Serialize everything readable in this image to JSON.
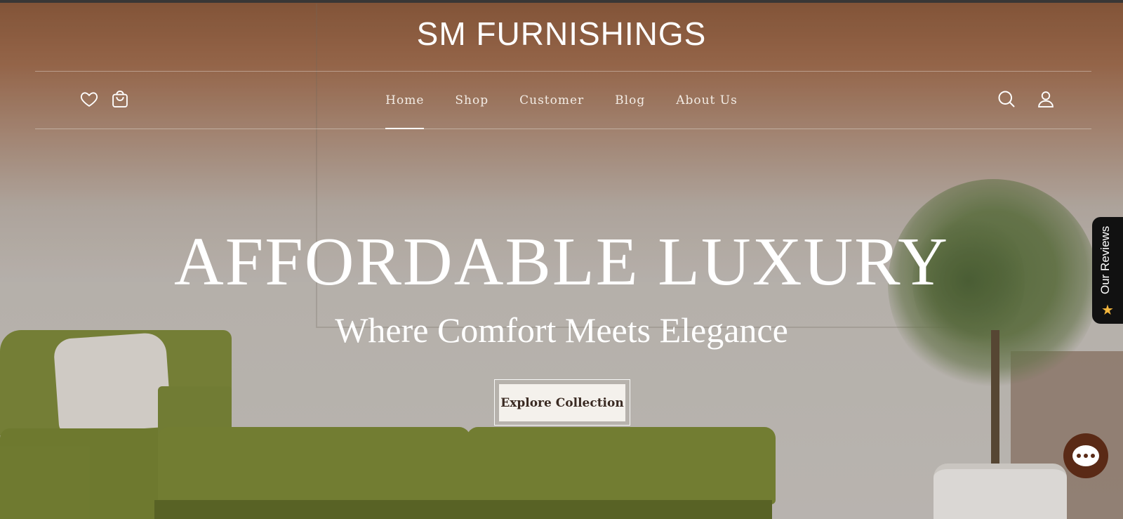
{
  "brand": {
    "name": "SM FURNISHINGS"
  },
  "header": {
    "nav": [
      {
        "label": "Home",
        "active": true
      },
      {
        "label": "Shop",
        "active": false
      },
      {
        "label": "Customer",
        "active": false
      },
      {
        "label": "Blog",
        "active": false
      },
      {
        "label": "About Us",
        "active": false
      }
    ],
    "left_icons": [
      "heart-icon",
      "shopping-bag-icon"
    ],
    "right_icons": [
      "search-icon",
      "user-icon"
    ]
  },
  "hero": {
    "headline": "AFFORDABLE LUXURY",
    "subheadline": "Where Comfort Meets Elegance",
    "cta_label": "Explore Collection"
  },
  "reviews_tab": {
    "label": "Our Reviews",
    "icon": "star-icon",
    "star_glyph": "★"
  },
  "chat": {
    "icon": "chat-bubble-icon"
  },
  "colors": {
    "header_tint": "#8c5a3c",
    "cta_background": "#f4f1ec",
    "cta_text": "#3a2a22",
    "reviews_tab_background": "#111111",
    "star": "#f4b73d",
    "chat_button": "#5a2a16"
  }
}
